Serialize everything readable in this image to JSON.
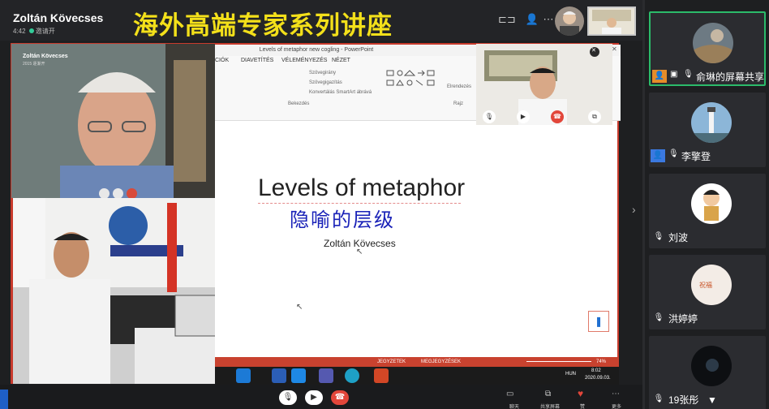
{
  "header": {
    "host_name": "Zoltán Kövecses",
    "host_time": "4:42",
    "banner": "海外高端专家系列讲座",
    "call_status": "邀请开"
  },
  "ppt": {
    "window_title": "Levels of metaphor new cogling - PowerPoint",
    "tabs": [
      "CIÓK",
      "DIAVETÍTÉS",
      "VÉLEMÉNYEZÉS",
      "NÉZET"
    ],
    "ribbon_items": [
      "Szövegirány",
      "Szövegigazítás",
      "Konvertálás SmartArt ábrává",
      "Elrendezés"
    ],
    "ribbon_groups": [
      "Bekezdés",
      "Rajz"
    ]
  },
  "slide": {
    "title": "Levels of metaphor",
    "subtitle": "隐喻的层级",
    "author": "Zoltán Kövecses"
  },
  "statusbar": {
    "notes": "JEGYZETEK",
    "comments": "MEGJEGYZÉSEK",
    "zoom": "74%"
  },
  "taskbar": {
    "lang": "HUN",
    "time": "8:02",
    "date": "2020.09.03."
  },
  "video1": {
    "name": "Zoltán Kövecses",
    "sub": "2015  逐渐开"
  },
  "participants": [
    {
      "name": "俞琳的屏幕共享",
      "icon": "person-icon"
    },
    {
      "name": "李擎登",
      "icon": "person-icon"
    },
    {
      "name": "刘波",
      "icon": "muted-mic-icon"
    },
    {
      "name": "洪婷婷",
      "icon": "muted-mic-icon"
    },
    {
      "name": "19张彤",
      "icon": "muted-mic-icon"
    }
  ],
  "bottom": {
    "chat": "聊天",
    "share": "共享屏幕",
    "like": "赞",
    "more": "更多"
  }
}
